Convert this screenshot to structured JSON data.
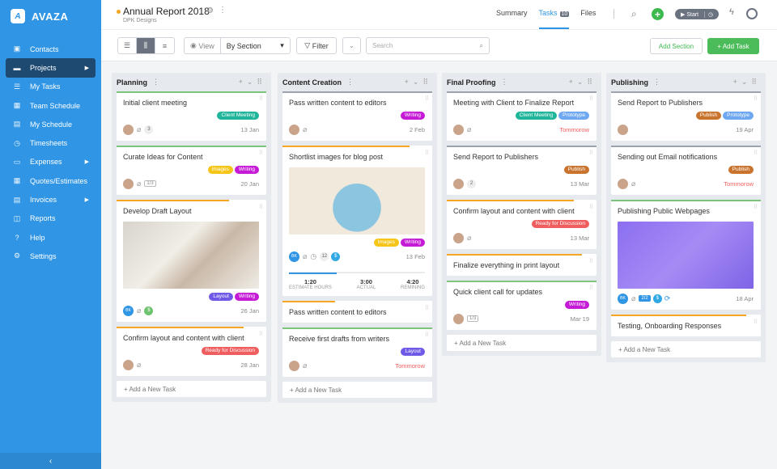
{
  "app": {
    "name": "AVAZA",
    "logo_glyph": "A"
  },
  "sidebar": {
    "items": [
      {
        "label": "Contacts",
        "icon": "contact-card-icon",
        "glyph": "▣",
        "arrow": false,
        "active": false
      },
      {
        "label": "Projects",
        "icon": "folder-icon",
        "glyph": "▬",
        "arrow": true,
        "active": true
      },
      {
        "label": "My Tasks",
        "icon": "task-list-icon",
        "glyph": "☰",
        "arrow": false,
        "active": false
      },
      {
        "label": "Team Schedule",
        "icon": "calendar-icon",
        "glyph": "▦",
        "arrow": false,
        "active": false
      },
      {
        "label": "My Schedule",
        "icon": "calendar-check-icon",
        "glyph": "▤",
        "arrow": false,
        "active": false
      },
      {
        "label": "Timesheets",
        "icon": "stopwatch-icon",
        "glyph": "◷",
        "arrow": false,
        "active": false
      },
      {
        "label": "Expenses",
        "icon": "expenses-icon",
        "glyph": "▭",
        "arrow": true,
        "active": false
      },
      {
        "label": "Quotes/Estimates",
        "icon": "calculator-icon",
        "glyph": "▦",
        "arrow": false,
        "active": false
      },
      {
        "label": "Invoices",
        "icon": "invoice-icon",
        "glyph": "▤",
        "arrow": true,
        "active": false
      },
      {
        "label": "Reports",
        "icon": "chart-icon",
        "glyph": "◫",
        "arrow": false,
        "active": false
      },
      {
        "label": "Help",
        "icon": "help-icon",
        "glyph": "?",
        "arrow": false,
        "active": false
      },
      {
        "label": "Settings",
        "icon": "gear-icon",
        "glyph": "⚙",
        "arrow": false,
        "active": false
      }
    ],
    "collapse_glyph": "‹"
  },
  "header": {
    "project_title": "Annual Report 2018",
    "project_client": "DPK Designs",
    "tabs": [
      {
        "label": "Summary",
        "active": false
      },
      {
        "label": "Tasks",
        "count": "10",
        "active": true
      },
      {
        "label": "Files",
        "active": false
      }
    ],
    "timer_label": "▶ Start",
    "timer_icon": "◷"
  },
  "toolbar": {
    "view_label": "View",
    "view_value": "By Section",
    "filter_label": "Filter",
    "search_placeholder": "Search",
    "add_section": "Add Section",
    "add_task": "+ Add Task"
  },
  "colors": {
    "sidebar": "#2f95e4",
    "accent": "#2f95e4",
    "green": "#4cbb5a",
    "orange": "#f5a623",
    "red": "#f05d5e"
  },
  "labels": {
    "client_meeting": {
      "text": "Client Meeting",
      "color": "#1fb59a"
    },
    "images": {
      "text": "Images",
      "color": "#f5c518"
    },
    "writing": {
      "text": "Writing",
      "color": "#c51ad6"
    },
    "layout": {
      "text": "Layout",
      "color": "#6f5ae8"
    },
    "ready": {
      "text": "Ready for Discussion",
      "color": "#f05d5e"
    },
    "prototype": {
      "text": "Prototype",
      "color": "#6fa8f0"
    },
    "publish": {
      "text": "Publish",
      "color": "#c9742e"
    }
  },
  "add_new_task": "+ Add a New Task",
  "columns": [
    {
      "title": "Planning",
      "cards": [
        {
          "title": "Initial client meeting",
          "bar": "#7cc47c",
          "bar_w": "100%",
          "labels": [
            "client_meeting"
          ],
          "avatar": "photo",
          "clip": true,
          "comments": "3",
          "date": "13 Jan"
        },
        {
          "title": "Curate Ideas for Content",
          "bar": "#7cc47c",
          "bar_w": "100%",
          "labels": [
            "images",
            "writing"
          ],
          "avatar": "photo",
          "clip": true,
          "subtasks": "1/3",
          "date": "20 Jan"
        },
        {
          "title": "Develop Draft Layout",
          "bar": "#f5a623",
          "bar_w": "75%",
          "image": "blueprint",
          "labels": [
            "layout",
            "writing"
          ],
          "avatar": "BK",
          "clip": true,
          "money": true,
          "date": "26 Jan"
        },
        {
          "title": "Confirm layout and content with client",
          "bar": "#f5a623",
          "bar_w": "85%",
          "labels": [
            "ready"
          ],
          "avatar": "photo",
          "clip": true,
          "date": "28 Jan"
        }
      ]
    },
    {
      "title": "Content Creation",
      "cards": [
        {
          "title": "Pass written content to editors",
          "bar": "#9ca3af",
          "bar_w": "100%",
          "labels": [
            "writing"
          ],
          "avatar": "photo",
          "clip": true,
          "date": "2 Feb"
        },
        {
          "title": "Shortlist images for blog post",
          "bar": "#f5a623",
          "bar_w": "85%",
          "image": "forest",
          "labels": [
            "images",
            "writing"
          ],
          "avatar": "BK",
          "clip": true,
          "clock": true,
          "comments": "12",
          "money": true,
          "date": "13 Feb",
          "estimate": {
            "progress": 0.35,
            "items": [
              {
                "value": "1:20",
                "label": "ESTIMATE HOURS"
              },
              {
                "value": "3:00",
                "label": "ACTUAL"
              },
              {
                "value": "4:20",
                "label": "REMINING"
              }
            ]
          }
        },
        {
          "title": "Pass written content to editors",
          "bar": "#f5a623",
          "bar_w": "35%"
        },
        {
          "title": "Receive first drafts from writers",
          "bar": "#7cc47c",
          "bar_w": "100%",
          "labels": [
            "layout"
          ],
          "avatar": "photo",
          "clip": true,
          "date": "Tommorow",
          "date_red": true
        }
      ]
    },
    {
      "title": "Final Proofing",
      "cards": [
        {
          "title": "Meeting with Client to Finalize Report",
          "bar": "#9ca3af",
          "bar_w": "100%",
          "labels": [
            "client_meeting",
            "prototype"
          ],
          "avatar": "photo",
          "clip": true,
          "date": "Tommorow",
          "date_red": true
        },
        {
          "title": "Send Report to Publishers",
          "bar": "#9ca3af",
          "bar_w": "100%",
          "labels": [
            "publish"
          ],
          "avatar": "photo",
          "comments": "2",
          "date": "13 Mar"
        },
        {
          "title": "Confirm layout and content with client",
          "bar": "#f5a623",
          "bar_w": "85%",
          "labels": [
            "ready"
          ],
          "avatar": "photo",
          "clip": true,
          "date": "13 Mar"
        },
        {
          "title": "Finalize everything in print layout",
          "bar": "#f5a623",
          "bar_w": "90%"
        },
        {
          "title": "Quick client call for updates",
          "bar": "#7cc47c",
          "bar_w": "100%",
          "labels": [
            "writing"
          ],
          "avatar": "photo",
          "subtasks": "1/3",
          "date": "Mar 19"
        }
      ]
    },
    {
      "title": "Publishing",
      "cards": [
        {
          "title": "Send Report to Publishers",
          "bar": "#9ca3af",
          "bar_w": "100%",
          "labels": [
            "publish",
            "prototype"
          ],
          "avatar": "photo",
          "date": "19 Apr"
        },
        {
          "title": "Sending out Email notifications",
          "bar": "#9ca3af",
          "bar_w": "100%",
          "labels": [
            "publish"
          ],
          "avatar": "photo",
          "clip": true,
          "date": "Tommorow",
          "date_red": true
        },
        {
          "title": "Publishing Public Webpages",
          "bar": "#7cc47c",
          "bar_w": "100%",
          "image": "dashboard",
          "avatar": "BK",
          "clip": true,
          "subtasks_blue": "2/2",
          "money": true,
          "repeat": true,
          "date": "18 Apr"
        },
        {
          "title": "Testing, Onboarding Responses",
          "bar": "#f5a623",
          "bar_w": "90%"
        }
      ]
    }
  ]
}
